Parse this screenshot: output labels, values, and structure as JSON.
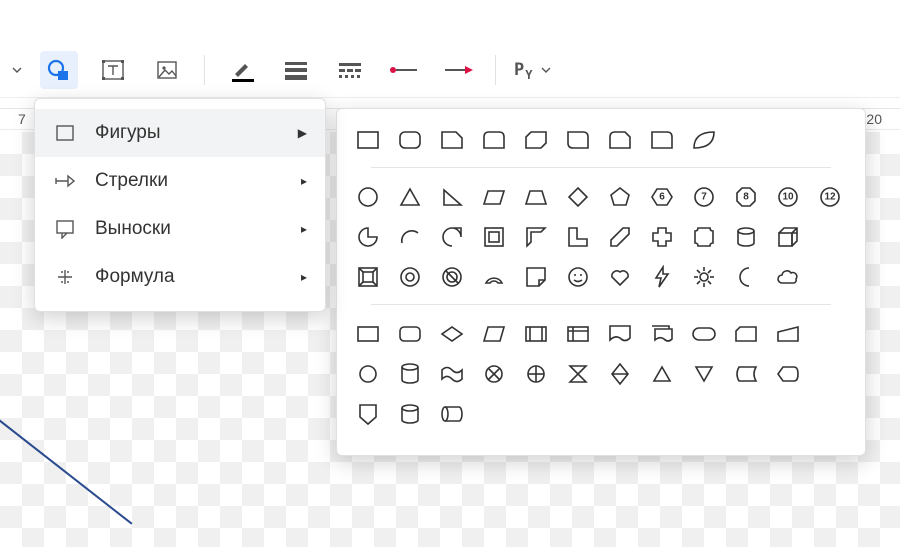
{
  "ruler": {
    "left_tick": "7",
    "right_tick": "20"
  },
  "toolbar": {
    "shape_tool": "Shape",
    "text_tool": "Text box",
    "image_tool": "Image",
    "line_color": "Line color",
    "line_weight": "Line weight",
    "line_dash": "Line dash",
    "line_start": "Line start",
    "line_end": "Line end",
    "py_label_p": "P",
    "py_label_y": "Y"
  },
  "menu": {
    "items": [
      {
        "label": "Фигуры",
        "icon": "square-icon",
        "active": true
      },
      {
        "label": "Стрелки",
        "icon": "arrow-right-icon",
        "active": false
      },
      {
        "label": "Выноски",
        "icon": "callout-icon",
        "active": false
      },
      {
        "label": "Формула",
        "icon": "plus-icon",
        "active": false
      }
    ]
  },
  "shapes_panel": {
    "group1_row1": [
      "rectangle",
      "rounded-rectangle",
      "snip-corner-rect",
      "rounded-top-rect",
      "snip-diag-rect",
      "rounded-diag-rect",
      "snip-round-rect",
      "half-round-rect",
      "leaf"
    ],
    "group2_row1": [
      "circle",
      "triangle",
      "right-triangle",
      "parallelogram",
      "trapezoid",
      "diamond",
      "pentagon",
      "hexagon",
      "heptagon",
      "octagon",
      "decagon",
      "dodecagon"
    ],
    "group2_row2": [
      "pie",
      "arc",
      "teardrop",
      "frame",
      "half-frame",
      "l-shape",
      "diag-stripe",
      "cross",
      "plaque",
      "cylinder",
      "cube"
    ],
    "group2_row3": [
      "bevel",
      "donut",
      "no-symbol",
      "block-arc",
      "folded-corner",
      "smiley",
      "heart",
      "lightning",
      "sun",
      "moon",
      "cloud"
    ],
    "group3_row1": [
      "flow-process",
      "flow-alt-process",
      "flow-decision",
      "flow-data",
      "flow-predef",
      "flow-internal",
      "flow-document",
      "flow-multidoc",
      "flow-terminator",
      "flow-card",
      "flow-manual-input"
    ],
    "group3_row2": [
      "flow-connector",
      "flow-database",
      "flow-tape",
      "flow-summing",
      "flow-or",
      "flow-collate",
      "flow-sort",
      "flow-extract",
      "flow-merge",
      "flow-stored",
      "flow-display"
    ],
    "group3_row3": [
      "flow-offpage",
      "flow-drum",
      "flow-direct-access"
    ],
    "polygon_numbers": {
      "heptagon": "7",
      "octagon": "8",
      "decagon": "10",
      "dodecagon": "12",
      "hexagon": "6"
    }
  }
}
